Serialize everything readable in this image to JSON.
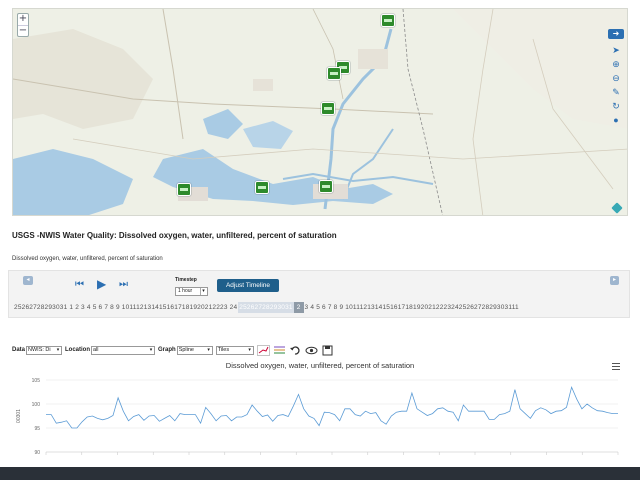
{
  "map": {
    "zoom_in": "+",
    "zoom_out": "−",
    "markers": 8,
    "tools": [
      "arrow",
      "pointer",
      "zoom-in",
      "zoom-out",
      "ruler",
      "refresh",
      "clock"
    ]
  },
  "title": "USGS -NWIS Water Quality: Dissolved oxygen, water, unfiltered, percent of saturation",
  "subtitle": "Dissolved oxygen, water, unfiltered, percent of saturation",
  "timeline": {
    "timestep_label": "Timestep",
    "timestep_value": "1 hour",
    "adjust_button": "Adjust Timeline",
    "dates_before": "25262728293031 1  2  3  4  5  6  7  8  9  1011121314151617181920212223 24",
    "dates_selected": "25262728293031",
    "dates_highlight": "2",
    "dates_after": "3  4  5  6  7  8  9  1011121314151617181920212223242526272829303111"
  },
  "toolbar": {
    "data_label": "Data",
    "data_value": "NWIS: Di",
    "location_label": "Location",
    "location_value": "all",
    "graph_label": "Graph",
    "graph_value": "Spline",
    "tiles_value": "Tiles"
  },
  "chart_data": {
    "type": "line",
    "title": "Dissolved oxygen, water, unfiltered, percent of saturation",
    "ylabel": "00301",
    "ylim": [
      90,
      105
    ],
    "yticks": [
      "105",
      "100",
      "95",
      "90"
    ],
    "color": "#5b9bd5",
    "values": [
      97.8,
      97.8,
      96.0,
      96.2,
      96.5,
      95.0,
      95.0,
      96.3,
      97.3,
      97.5,
      97.0,
      96.7,
      97.0,
      97.6,
      101.3,
      98.5,
      96.5,
      97.4,
      97.8,
      96.6,
      97.5,
      97.6,
      96.4,
      97.0,
      97.6,
      96.5,
      98.0,
      97.8,
      97.8,
      97.8,
      96.0,
      99.3,
      98.0,
      96.5,
      97.5,
      97.6,
      96.5,
      97.3,
      97.3,
      97.8,
      99.8,
      98.5,
      97.4,
      97.7,
      96.4,
      97.6,
      97.8,
      97.4,
      99.6,
      102.0,
      99.0,
      97.5,
      97.0,
      95.5,
      98.3,
      98.2,
      97.8,
      96.5,
      99.0,
      99.0,
      97.8,
      97.5,
      98.5,
      98.0,
      98.2,
      96.5,
      95.8,
      97.5,
      98.3,
      98.5,
      98.5,
      102.3,
      99.0,
      98.3,
      97.6,
      98.0,
      99.0,
      99.2,
      98.5,
      98.3,
      96.5,
      99.8,
      98.5,
      98.5,
      98.5,
      98.5,
      96.8,
      96.8,
      97.8,
      98.0,
      98.5,
      103.0,
      99.0,
      98.0,
      97.0,
      98.6,
      99.2,
      98.8,
      98.0,
      98.5,
      98.6,
      99.3,
      103.5,
      101.0,
      99.0,
      100.0,
      99.2,
      98.6,
      98.5,
      98.2,
      98.0,
      98.0
    ],
    "x_tick_count": 16
  },
  "colors": {
    "accent": "#1f5f8b",
    "marker": "#2d8a2b",
    "water": "#a9cbe4",
    "taskbar": "#2a3038"
  }
}
